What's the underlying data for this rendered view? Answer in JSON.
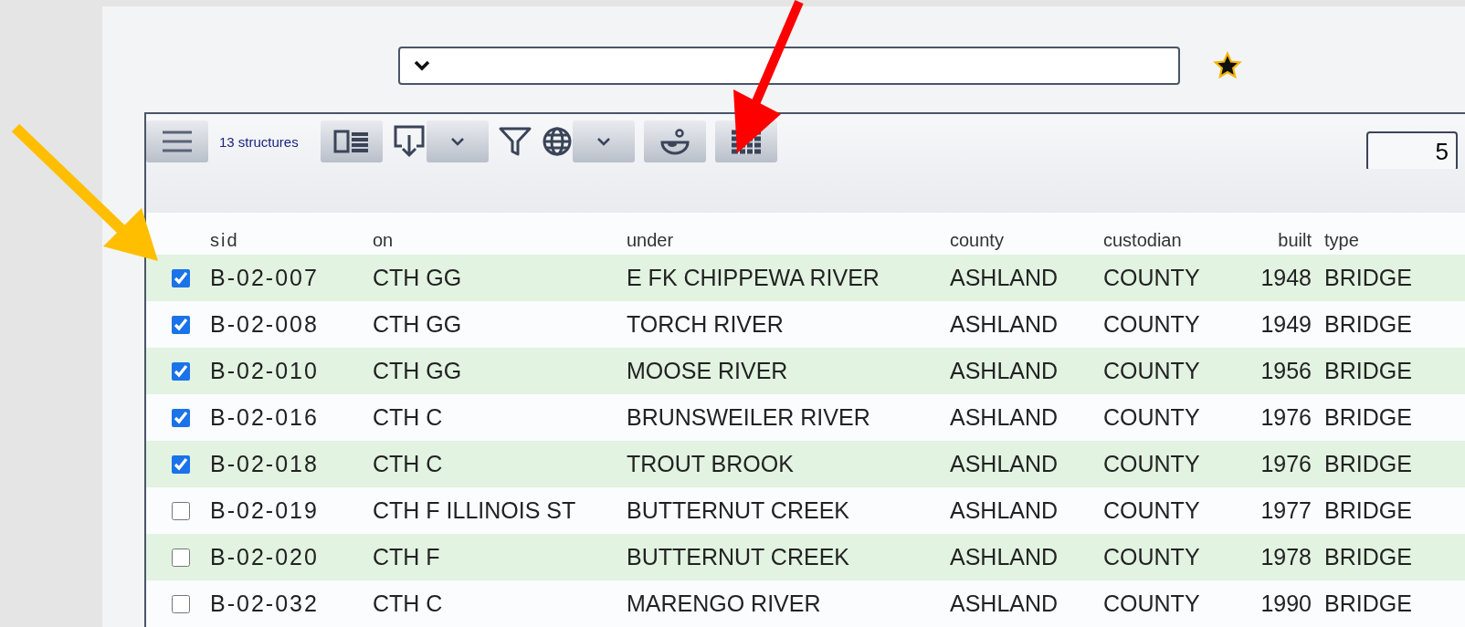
{
  "toolbar": {
    "count": "13 structures",
    "page_size": "5"
  },
  "table": {
    "columns": [
      "sid",
      "on",
      "under",
      "county",
      "custodian",
      "built",
      "type"
    ],
    "rows": [
      {
        "checked": true,
        "cells": [
          "B-02-007",
          "CTH GG",
          "E FK CHIPPEWA RIVER",
          "ASHLAND",
          "COUNTY",
          "1948",
          "BRIDGE"
        ]
      },
      {
        "checked": true,
        "cells": [
          "B-02-008",
          "CTH GG",
          "TORCH RIVER",
          "ASHLAND",
          "COUNTY",
          "1949",
          "BRIDGE"
        ]
      },
      {
        "checked": true,
        "cells": [
          "B-02-010",
          "CTH GG",
          "MOOSE RIVER",
          "ASHLAND",
          "COUNTY",
          "1956",
          "BRIDGE"
        ]
      },
      {
        "checked": true,
        "cells": [
          "B-02-016",
          "CTH C",
          "BRUNSWEILER RIVER",
          "ASHLAND",
          "COUNTY",
          "1976",
          "BRIDGE"
        ]
      },
      {
        "checked": true,
        "cells": [
          "B-02-018",
          "CTH C",
          "TROUT BROOK",
          "ASHLAND",
          "COUNTY",
          "1976",
          "BRIDGE"
        ]
      },
      {
        "checked": false,
        "cells": [
          "B-02-019",
          "CTH F ILLINOIS ST",
          "BUTTERNUT CREEK",
          "ASHLAND",
          "COUNTY",
          "1977",
          "BRIDGE"
        ]
      },
      {
        "checked": false,
        "cells": [
          "B-02-020",
          "CTH F",
          "BUTTERNUT CREEK",
          "ASHLAND",
          "COUNTY",
          "1978",
          "BRIDGE"
        ]
      },
      {
        "checked": false,
        "cells": [
          "B-02-032",
          "CTH C",
          "MARENGO RIVER",
          "ASHLAND",
          "COUNTY",
          "1990",
          "BRIDGE"
        ]
      }
    ]
  }
}
